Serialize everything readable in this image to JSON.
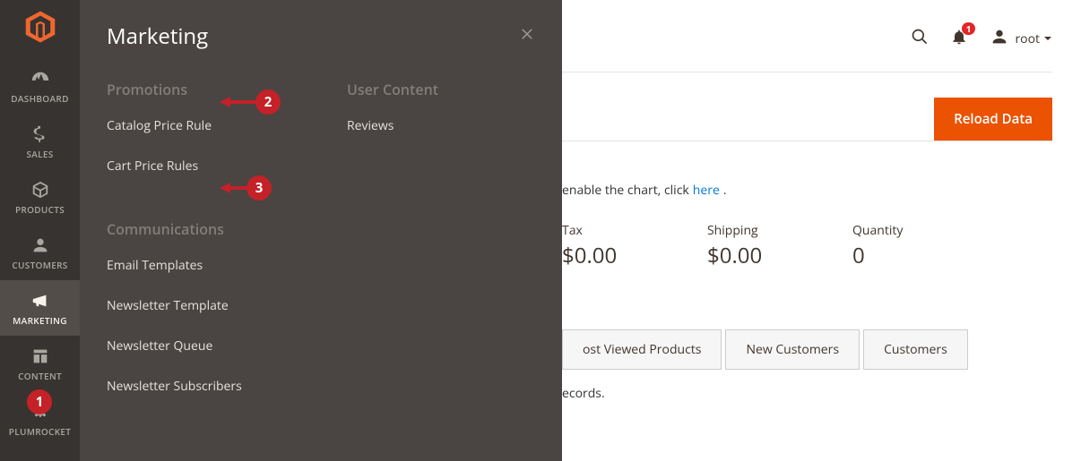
{
  "sidebar": {
    "items": [
      {
        "label": "DASHBOARD"
      },
      {
        "label": "SALES"
      },
      {
        "label": "PRODUCTS"
      },
      {
        "label": "CUSTOMERS"
      },
      {
        "label": "MARKETING"
      },
      {
        "label": "CONTENT"
      },
      {
        "label": "PLUMROCKET"
      }
    ]
  },
  "submenu": {
    "title": "Marketing",
    "promotions_heading": "Promotions",
    "promotions": [
      {
        "label": "Catalog Price Rule"
      },
      {
        "label": "Cart Price Rules"
      }
    ],
    "communications_heading": "Communications",
    "communications": [
      {
        "label": "Email Templates"
      },
      {
        "label": "Newsletter Template"
      },
      {
        "label": "Newsletter Queue"
      },
      {
        "label": "Newsletter Subscribers"
      }
    ],
    "user_content_heading": "User Content",
    "user_content": [
      {
        "label": "Reviews"
      }
    ]
  },
  "annotations": {
    "b1": "1",
    "b2": "2",
    "b3": "3"
  },
  "header": {
    "notif_count": "1",
    "username": "root"
  },
  "main": {
    "reload_label": "Reload Data",
    "chart_enable_prefix": "enable the chart, click ",
    "chart_enable_link": "here",
    "chart_enable_suffix": ".",
    "stats": [
      {
        "label": "Tax",
        "value": "$0.00"
      },
      {
        "label": "Shipping",
        "value": "$0.00"
      },
      {
        "label": "Quantity",
        "value": "0"
      }
    ],
    "tabs": [
      {
        "label": "ost Viewed Products"
      },
      {
        "label": "New Customers"
      },
      {
        "label": "Customers"
      }
    ],
    "records_line": "ecords."
  }
}
